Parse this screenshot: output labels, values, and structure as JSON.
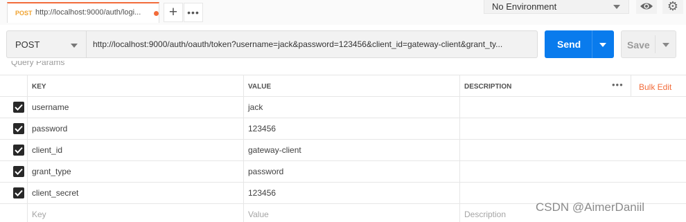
{
  "tab": {
    "method": "POST",
    "url": "http://localhost:9000/auth/logi..."
  },
  "toolbar": {
    "add_label": "+",
    "more_label": "•••"
  },
  "environment": {
    "selected": "No Environment"
  },
  "request": {
    "method": "POST",
    "url": "http://localhost:9000/auth/oauth/token?username=jack&password=123456&client_id=gateway-client&grant_ty...",
    "send_label": "Send",
    "save_label": "Save"
  },
  "params": {
    "section_label": "Query Params",
    "headers": {
      "key": "KEY",
      "value": "VALUE",
      "description": "DESCRIPTION"
    },
    "more_label": "•••",
    "bulk_edit_label": "Bulk Edit",
    "rows": [
      {
        "checked": true,
        "key": "username",
        "value": "jack",
        "description": ""
      },
      {
        "checked": true,
        "key": "password",
        "value": "123456",
        "description": ""
      },
      {
        "checked": true,
        "key": "client_id",
        "value": "gateway-client",
        "description": ""
      },
      {
        "checked": true,
        "key": "grant_type",
        "value": "password",
        "description": ""
      },
      {
        "checked": true,
        "key": "client_secret",
        "value": "123456",
        "description": ""
      }
    ],
    "placeholder": {
      "key": "Key",
      "value": "Value",
      "description": "Description"
    }
  },
  "colors": {
    "accent": "#f26b3a",
    "send": "#097bed",
    "checkbox": "#282828"
  },
  "icons": {
    "eye": "eye-icon",
    "gear": "gear-icon",
    "check": "check-icon",
    "caret": "chevron-down-icon"
  },
  "watermark": "CSDN @AimerDaniil"
}
